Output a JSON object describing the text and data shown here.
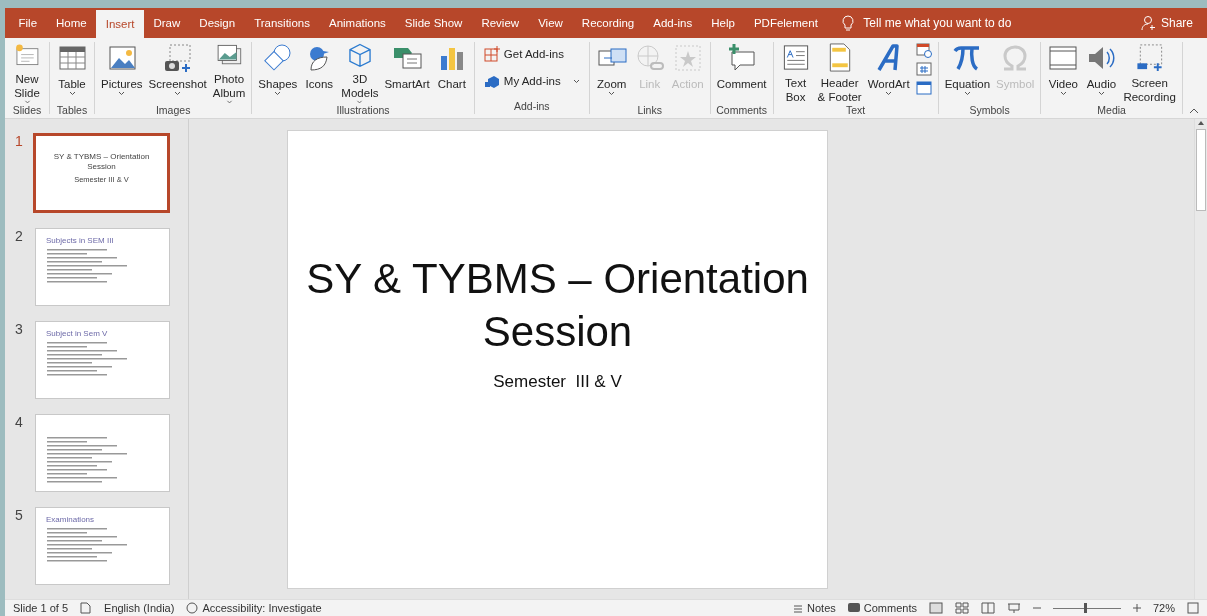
{
  "tabs": [
    {
      "label": "File",
      "selected": false
    },
    {
      "label": "Home",
      "selected": false
    },
    {
      "label": "Insert",
      "selected": true
    },
    {
      "label": "Draw",
      "selected": false
    },
    {
      "label": "Design",
      "selected": false
    },
    {
      "label": "Transitions",
      "selected": false
    },
    {
      "label": "Animations",
      "selected": false
    },
    {
      "label": "Slide Show",
      "selected": false
    },
    {
      "label": "Review",
      "selected": false
    },
    {
      "label": "View",
      "selected": false
    },
    {
      "label": "Recording",
      "selected": false
    },
    {
      "label": "Add-ins",
      "selected": false
    },
    {
      "label": "Help",
      "selected": false
    },
    {
      "label": "PDFelement",
      "selected": false
    }
  ],
  "tell_me": "Tell me what you want to do",
  "share": "Share",
  "ribbon_groups": [
    {
      "name": "Slides",
      "buttons": [
        {
          "kind": "large",
          "label": "New\nSlide",
          "dropdown": true,
          "disabled": false
        }
      ]
    },
    {
      "name": "Tables",
      "buttons": [
        {
          "kind": "large",
          "label": "Table",
          "dropdown": true,
          "disabled": false
        }
      ]
    },
    {
      "name": "Images",
      "buttons": [
        {
          "kind": "large",
          "label": "Pictures",
          "dropdown": true,
          "disabled": false
        },
        {
          "kind": "large",
          "label": "Screenshot",
          "dropdown": true,
          "disabled": false
        },
        {
          "kind": "large",
          "label": "Photo\nAlbum",
          "dropdown": true,
          "disabled": false
        }
      ]
    },
    {
      "name": "Illustrations",
      "buttons": [
        {
          "kind": "large",
          "label": "Shapes",
          "dropdown": true,
          "disabled": false
        },
        {
          "kind": "large",
          "label": "Icons",
          "dropdown": false,
          "disabled": false
        },
        {
          "kind": "large",
          "label": "3D\nModels",
          "dropdown": true,
          "disabled": false
        },
        {
          "kind": "large",
          "label": "SmartArt",
          "dropdown": false,
          "disabled": false
        },
        {
          "kind": "large",
          "label": "Chart",
          "dropdown": false,
          "disabled": false
        }
      ]
    },
    {
      "name": "Add-ins",
      "buttons": [
        {
          "kind": "small",
          "label": "Get Add-ins",
          "dropdown": false,
          "disabled": false
        },
        {
          "kind": "small",
          "label": "My Add-ins",
          "dropdown": true,
          "disabled": false
        }
      ]
    },
    {
      "name": "Links",
      "buttons": [
        {
          "kind": "large",
          "label": "Zoom",
          "dropdown": true,
          "disabled": false
        },
        {
          "kind": "large",
          "label": "Link",
          "dropdown": false,
          "disabled": true
        },
        {
          "kind": "large",
          "label": "Action",
          "dropdown": false,
          "disabled": true
        }
      ]
    },
    {
      "name": "Comments",
      "buttons": [
        {
          "kind": "large",
          "label": "Comment",
          "dropdown": false,
          "disabled": false
        }
      ]
    },
    {
      "name": "Text",
      "buttons": [
        {
          "kind": "large",
          "label": "Text\nBox",
          "dropdown": false,
          "disabled": false
        },
        {
          "kind": "large",
          "label": "Header\n& Footer",
          "dropdown": false,
          "disabled": false
        },
        {
          "kind": "large",
          "label": "WordArt",
          "dropdown": true,
          "disabled": false
        },
        {
          "kind": "stack"
        }
      ]
    },
    {
      "name": "Symbols",
      "buttons": [
        {
          "kind": "large",
          "label": "Equation",
          "dropdown": true,
          "disabled": false
        },
        {
          "kind": "large",
          "label": "Symbol",
          "dropdown": false,
          "disabled": true
        }
      ]
    },
    {
      "name": "Media",
      "buttons": [
        {
          "kind": "large",
          "label": "Video",
          "dropdown": true,
          "disabled": false
        },
        {
          "kind": "large",
          "label": "Audio",
          "dropdown": true,
          "disabled": false
        },
        {
          "kind": "large",
          "label": "Screen\nRecording",
          "dropdown": false,
          "disabled": false
        }
      ]
    }
  ],
  "slides": [
    {
      "number": "1",
      "selected": true,
      "kind": "title",
      "title": "SY & TYBMS – Orientation Session",
      "subtitle": "Semester III & V"
    },
    {
      "number": "2",
      "selected": false,
      "kind": "content",
      "title": "Subjects in SEM III"
    },
    {
      "number": "3",
      "selected": false,
      "kind": "content",
      "title": "Subject in Sem V"
    },
    {
      "number": "4",
      "selected": false,
      "kind": "bullets"
    },
    {
      "number": "5",
      "selected": false,
      "kind": "content",
      "title": "Examinations"
    }
  ],
  "slide": {
    "title": "SY & TYBMS – Orientation Session",
    "subtitle": "Semester  III & V"
  },
  "status_bar": {
    "slide_info": "Slide 1 of 5",
    "language": "English (India)",
    "accessibility": "Accessibility: Investigate",
    "notes": "Notes",
    "comments": "Comments",
    "zoom": {
      "level": 0.45,
      "reading": "72%"
    }
  }
}
